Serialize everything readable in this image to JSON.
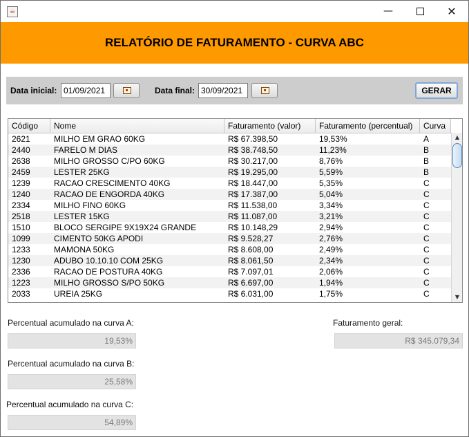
{
  "window": {
    "app_icon": "java-icon",
    "minimize_glyph": "—",
    "close_glyph": "✕"
  },
  "header": {
    "title": "RELATÓRIO DE FATURAMENTO - CURVA ABC",
    "background": "#ff9900"
  },
  "filters": {
    "start_label": "Data inicial:",
    "start_value": "01/09/2021",
    "end_label": "Data final:",
    "end_value": "30/09/2021",
    "calendar_icon": "calendar-icon",
    "generate_label": "GERAR"
  },
  "table": {
    "columns": [
      "Código",
      "Nome",
      "Faturamento (valor)",
      "Faturamento (percentual)",
      "Curva"
    ],
    "rows": [
      [
        "2621",
        "MILHO EM GRAO 60KG",
        "R$ 67.398,50",
        "19,53%",
        "A"
      ],
      [
        "2440",
        "FARELO M DIAS",
        "R$ 38.748,50",
        "11,23%",
        "B"
      ],
      [
        "2638",
        "MILHO GROSSO C/PO 60KG",
        "R$ 30.217,00",
        "8,76%",
        "B"
      ],
      [
        "2459",
        "LESTER 25KG",
        "R$ 19.295,00",
        "5,59%",
        "B"
      ],
      [
        "1239",
        "RACAO CRESCIMENTO 40KG",
        "R$ 18.447,00",
        "5,35%",
        "C"
      ],
      [
        "1240",
        "RACAO DE  ENGORDA 40KG",
        "R$ 17.387,00",
        "5,04%",
        "C"
      ],
      [
        "2334",
        "MILHO FINO 60KG",
        "R$ 11.538,00",
        "3,34%",
        "C"
      ],
      [
        "2518",
        "LESTER 15KG",
        "R$ 11.087,00",
        "3,21%",
        "C"
      ],
      [
        "1510",
        "BLOCO SERGIPE 9X19X24 GRANDE",
        "R$ 10.148,29",
        "2,94%",
        "C"
      ],
      [
        "1099",
        "CIMENTO 50KG APODI",
        "R$ 9.528,27",
        "2,76%",
        "C"
      ],
      [
        "1233",
        "MAMONA 50KG",
        "R$ 8.608,00",
        "2,49%",
        "C"
      ],
      [
        "1230",
        "ADUBO 10.10.10 COM 25KG",
        "R$ 8.061,50",
        "2,34%",
        "C"
      ],
      [
        "2336",
        "RACAO DE POSTURA 40KG",
        "R$ 7.097,01",
        "2,06%",
        "C"
      ],
      [
        "1223",
        "MILHO GROSSO S/PO 50KG",
        "R$ 6.697,00",
        "1,94%",
        "C"
      ],
      [
        "2033",
        "UREIA 25KG",
        "R$ 6.031,00",
        "1,75%",
        "C"
      ]
    ],
    "scroll_up_glyph": "▲",
    "scroll_down_glyph": "▼"
  },
  "summary": {
    "curve_a_label": "Percentual acumulado na curva A:",
    "curve_a_value": "19,53%",
    "curve_b_label": "Percentual acumulado na curva B:",
    "curve_b_value": "25,58%",
    "curve_c_label": "Percentual acumulado na curva C:",
    "curve_c_value": "54,89%",
    "total_label": "Faturamento geral:",
    "total_value": "R$ 345.079,34"
  }
}
